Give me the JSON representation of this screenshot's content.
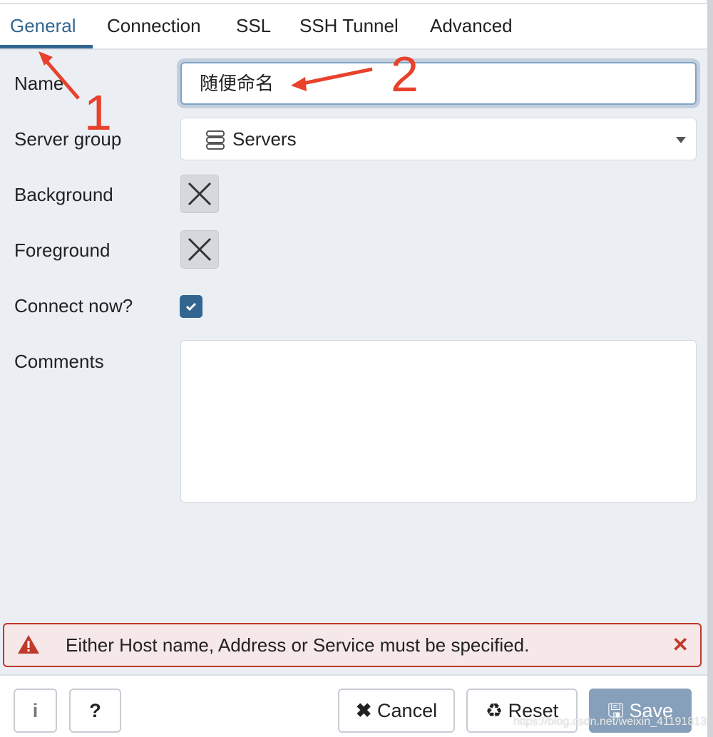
{
  "tabs": [
    {
      "label": "General",
      "active": true
    },
    {
      "label": "Connection"
    },
    {
      "label": "SSL"
    },
    {
      "label": "SSH Tunnel"
    },
    {
      "label": "Advanced"
    }
  ],
  "form": {
    "name_label": "Name",
    "name_value": "随便命名",
    "server_group_label": "Server group",
    "server_group_value": "Servers",
    "background_label": "Background",
    "foreground_label": "Foreground",
    "connect_now_label": "Connect now?",
    "connect_now_checked": true,
    "comments_label": "Comments",
    "comments_value": ""
  },
  "alert": {
    "message": "Either Host name, Address or Service must be specified.",
    "color": "#c0392b"
  },
  "footer": {
    "info_label": "i",
    "help_label": "?",
    "cancel_label": "Cancel",
    "reset_label": "Reset",
    "save_label": "Save"
  },
  "annotations": {
    "one": "1",
    "two": "2"
  },
  "watermark": "https://blog.csdn.net/weixin_41191813",
  "accent": "#326690"
}
